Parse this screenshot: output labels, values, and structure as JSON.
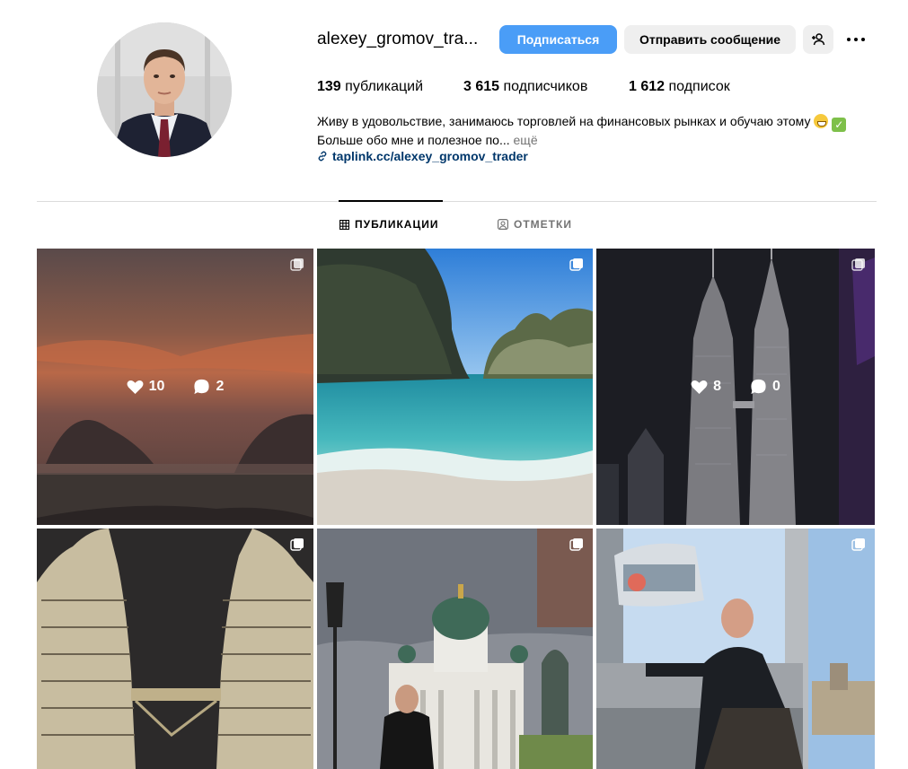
{
  "profile": {
    "username": "alexey_gromov_tra...",
    "follow_label": "Подписаться",
    "message_label": "Отправить сообщение",
    "stats": {
      "posts_count": "139",
      "posts_label": "публикаций",
      "followers_count": "3 615",
      "followers_label": "подписчиков",
      "following_count": "1 612",
      "following_label": "подписок"
    },
    "bio": {
      "line1": "Живу в удовольствие, занимаюсь торговлей на финансовых рынках и обучаю этому",
      "line2": "Больше обо мне и полезное по...",
      "more": "ещё",
      "link": "taplink.cc/alexey_gromov_trader"
    }
  },
  "tabs": [
    {
      "label": "ПУБЛИКАЦИИ",
      "icon": "grid-icon",
      "active": true
    },
    {
      "label": "ОТМЕТКИ",
      "icon": "tagged-user-icon",
      "active": false
    }
  ],
  "posts": [
    {
      "subject": "sunset-islands",
      "multi": true,
      "likes": "10",
      "comments": "2",
      "hover": true
    },
    {
      "subject": "tropical-bay",
      "multi": true
    },
    {
      "subject": "petronas-towers-night",
      "multi": true,
      "likes": "8",
      "comments": "0",
      "hover": true
    },
    {
      "subject": "petronas-towers-closeup",
      "multi": true
    },
    {
      "subject": "helsinki-cathedral",
      "multi": true
    },
    {
      "subject": "ferris-wheel-cabin",
      "multi": true
    }
  ],
  "colors": {
    "accent": "#4a9df7",
    "link": "#00376b",
    "muted": "#737373",
    "divider": "#dbdbdb",
    "button_secondary": "#efefef",
    "selected_outline": "#8ccf77"
  }
}
